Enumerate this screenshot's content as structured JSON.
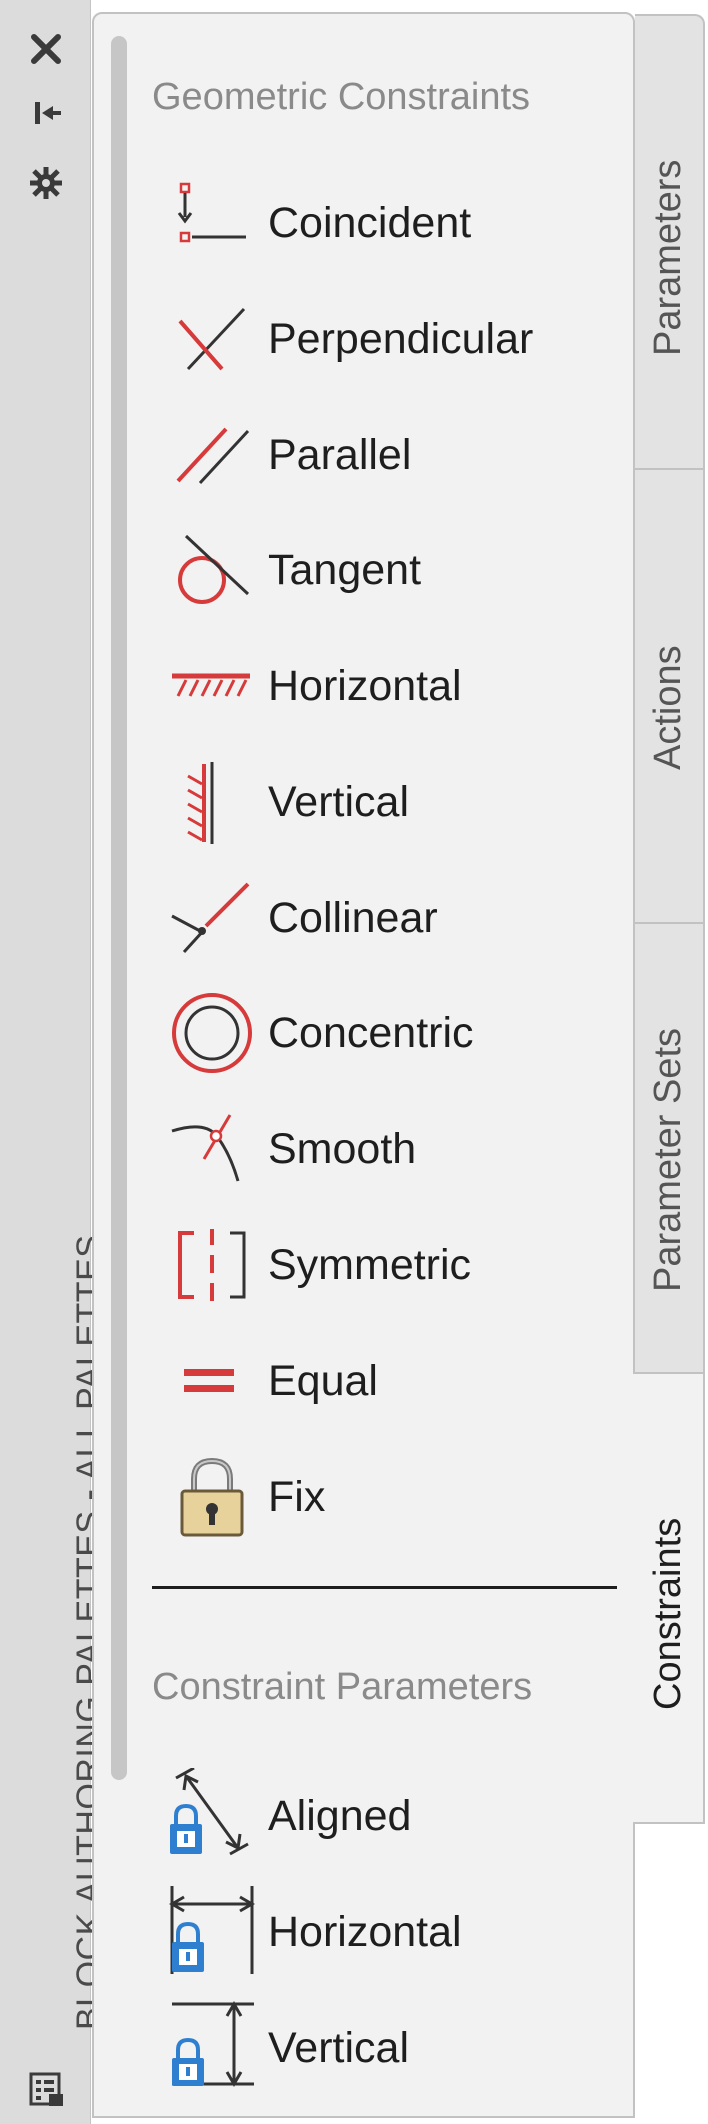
{
  "window": {
    "title": "BLOCK AUTHORING PALETTES - ALL PALETTES"
  },
  "colors": {
    "accent_red": "#d63a3a",
    "lock_blue": "#2f7fd1",
    "text": "#1e1e1e",
    "section": "#8a8a8a"
  },
  "titlebar_icons": [
    "close-icon",
    "auto-hide-icon",
    "properties-icon",
    "palette-menu-icon"
  ],
  "geometric": {
    "title": "Geometric Constraints",
    "items": [
      {
        "label": "Coincident",
        "icon": "coincident-icon"
      },
      {
        "label": "Perpendicular",
        "icon": "perpendicular-icon"
      },
      {
        "label": "Parallel",
        "icon": "parallel-icon"
      },
      {
        "label": "Tangent",
        "icon": "tangent-icon"
      },
      {
        "label": "Horizontal",
        "icon": "horizontal-constraint-icon"
      },
      {
        "label": "Vertical",
        "icon": "vertical-constraint-icon"
      },
      {
        "label": "Collinear",
        "icon": "collinear-icon"
      },
      {
        "label": "Concentric",
        "icon": "concentric-icon"
      },
      {
        "label": "Smooth",
        "icon": "smooth-icon"
      },
      {
        "label": "Symmetric",
        "icon": "symmetric-icon"
      },
      {
        "label": "Equal",
        "icon": "equal-icon"
      },
      {
        "label": "Fix",
        "icon": "fix-lock-icon"
      }
    ]
  },
  "parameters_section": {
    "title": "Constraint Parameters",
    "items": [
      {
        "label": "Aligned",
        "icon": "aligned-dimension-icon"
      },
      {
        "label": "Horizontal",
        "icon": "horizontal-dimension-icon"
      },
      {
        "label": "Vertical",
        "icon": "vertical-dimension-icon"
      }
    ]
  },
  "tabs": [
    {
      "label": "Parameters",
      "active": false
    },
    {
      "label": "Actions",
      "active": false
    },
    {
      "label": "Parameter Sets",
      "active": false
    },
    {
      "label": "Constraints",
      "active": true
    }
  ]
}
